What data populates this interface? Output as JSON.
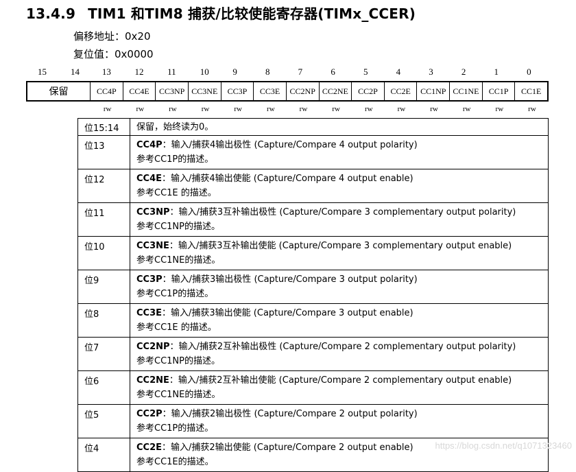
{
  "header": {
    "section": "13.4.9",
    "title": "TIM1 和TIM8 捕获/比较使能寄存器(TIMx_CCER)",
    "offset_label": "偏移地址：0x20",
    "reset_label": "复位值：0x0000"
  },
  "bit_numbers": [
    "15",
    "14",
    "13",
    "12",
    "11",
    "10",
    "9",
    "8",
    "7",
    "6",
    "5",
    "4",
    "3",
    "2",
    "1",
    "0"
  ],
  "register_fields": [
    "保留",
    "CC4P",
    "CC4E",
    "CC3NP",
    "CC3NE",
    "CC3P",
    "CC3E",
    "CC2NP",
    "CC2NE",
    "CC2P",
    "CC2E",
    "CC1NP",
    "CC1NE",
    "CC1P",
    "CC1E"
  ],
  "access": [
    "rw",
    "rw",
    "rw",
    "rw",
    "rw",
    "rw",
    "rw",
    "rw",
    "rw",
    "rw",
    "rw",
    "rw",
    "rw",
    "rw"
  ],
  "descriptions": [
    {
      "bit": "位15:14",
      "name": "",
      "desc": "保留，始终读为0。",
      "ref": ""
    },
    {
      "bit": "位13",
      "name": "CC4P",
      "desc": "：输入/捕获4输出极性 (Capture/Compare 4 output polarity)",
      "ref": "参考CC1P的描述。"
    },
    {
      "bit": "位12",
      "name": "CC4E",
      "desc": "：输入/捕获4输出使能 (Capture/Compare 4 output enable)",
      "ref": "参考CC1E 的描述。"
    },
    {
      "bit": "位11",
      "name": "CC3NP",
      "desc": "：输入/捕获3互补输出极性 (Capture/Compare 3 complementary output polarity)",
      "ref": "参考CC1NP的描述。"
    },
    {
      "bit": "位10",
      "name": "CC3NE",
      "desc": "：输入/捕获3互补输出使能 (Capture/Compare 3 complementary output enable)",
      "ref": "参考CC1NE的描述。"
    },
    {
      "bit": "位9",
      "name": "CC3P",
      "desc": "：输入/捕获3输出极性 (Capture/Compare 3 output polarity)",
      "ref": "参考CC1P的描述。"
    },
    {
      "bit": "位8",
      "name": "CC3E",
      "desc": "：输入/捕获3输出使能 (Capture/Compare 3 output enable)",
      "ref": "参考CC1E 的描述。"
    },
    {
      "bit": "位7",
      "name": "CC2NP",
      "desc": "：输入/捕获2互补输出极性 (Capture/Compare 2 complementary output polarity)",
      "ref": "参考CC1NP的描述。"
    },
    {
      "bit": "位6",
      "name": "CC2NE",
      "desc": "：输入/捕获2互补输出使能 (Capture/Compare 2 complementary output enable)",
      "ref": "参考CC1NE的描述。"
    },
    {
      "bit": "位5",
      "name": "CC2P",
      "desc": "：输入/捕获2输出极性 (Capture/Compare 2 output polarity)",
      "ref": "参考CC1P的描述。"
    },
    {
      "bit": "位4",
      "name": "CC2E",
      "desc": "：输入/捕获2输出使能 (Capture/Compare 2 output enable)",
      "ref": "参考CC1E的描述。"
    }
  ],
  "watermark": "https://blog.csdn.net/q1071323460"
}
